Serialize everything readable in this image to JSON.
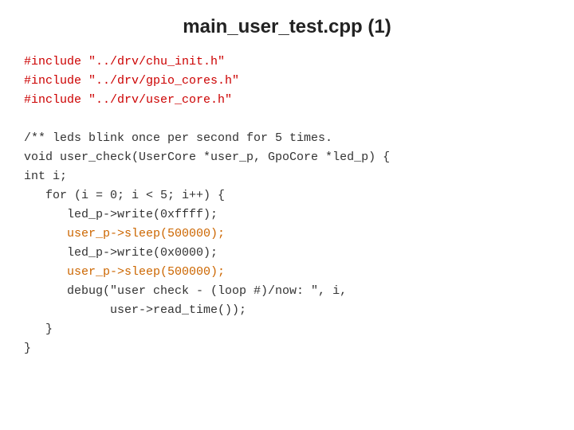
{
  "header": {
    "title": "main_user_test.cpp (1)"
  },
  "code": {
    "lines": [
      {
        "id": "include1",
        "text": "#include \"../drv/chu_init.h\"",
        "color": "red"
      },
      {
        "id": "include2",
        "text": "#include \"../drv/gpio_cores.h\"",
        "color": "red"
      },
      {
        "id": "include3",
        "text": "#include \"../drv/user_core.h\"",
        "color": "red"
      },
      {
        "id": "empty1",
        "text": "",
        "color": "black"
      },
      {
        "id": "comment",
        "text": "/** leds blink once per second for 5 times.",
        "color": "black"
      },
      {
        "id": "func_sig",
        "text": "void user_check(UserCore *user_p, GpoCore *led_p) {",
        "color": "black"
      },
      {
        "id": "int_i",
        "text": "int i;",
        "color": "black"
      },
      {
        "id": "for_loop",
        "text": "   for (i = 0; i < 5; i++) {",
        "color": "black"
      },
      {
        "id": "led_write1",
        "text": "      led_p->write(0xffff);",
        "color": "black"
      },
      {
        "id": "user_sleep1",
        "text": "      user_p->sleep(500000);",
        "color": "orange"
      },
      {
        "id": "led_write2",
        "text": "      led_p->write(0x0000);",
        "color": "black"
      },
      {
        "id": "user_sleep2",
        "text": "      user_p->sleep(500000);",
        "color": "orange"
      },
      {
        "id": "debug1",
        "text": "      debug(\"user check - (loop #)/now: \", i,",
        "color": "black"
      },
      {
        "id": "debug2",
        "text": "            user->read_time());",
        "color": "black"
      },
      {
        "id": "for_close",
        "text": "   }",
        "color": "black"
      },
      {
        "id": "func_close",
        "text": "}",
        "color": "black"
      }
    ]
  }
}
